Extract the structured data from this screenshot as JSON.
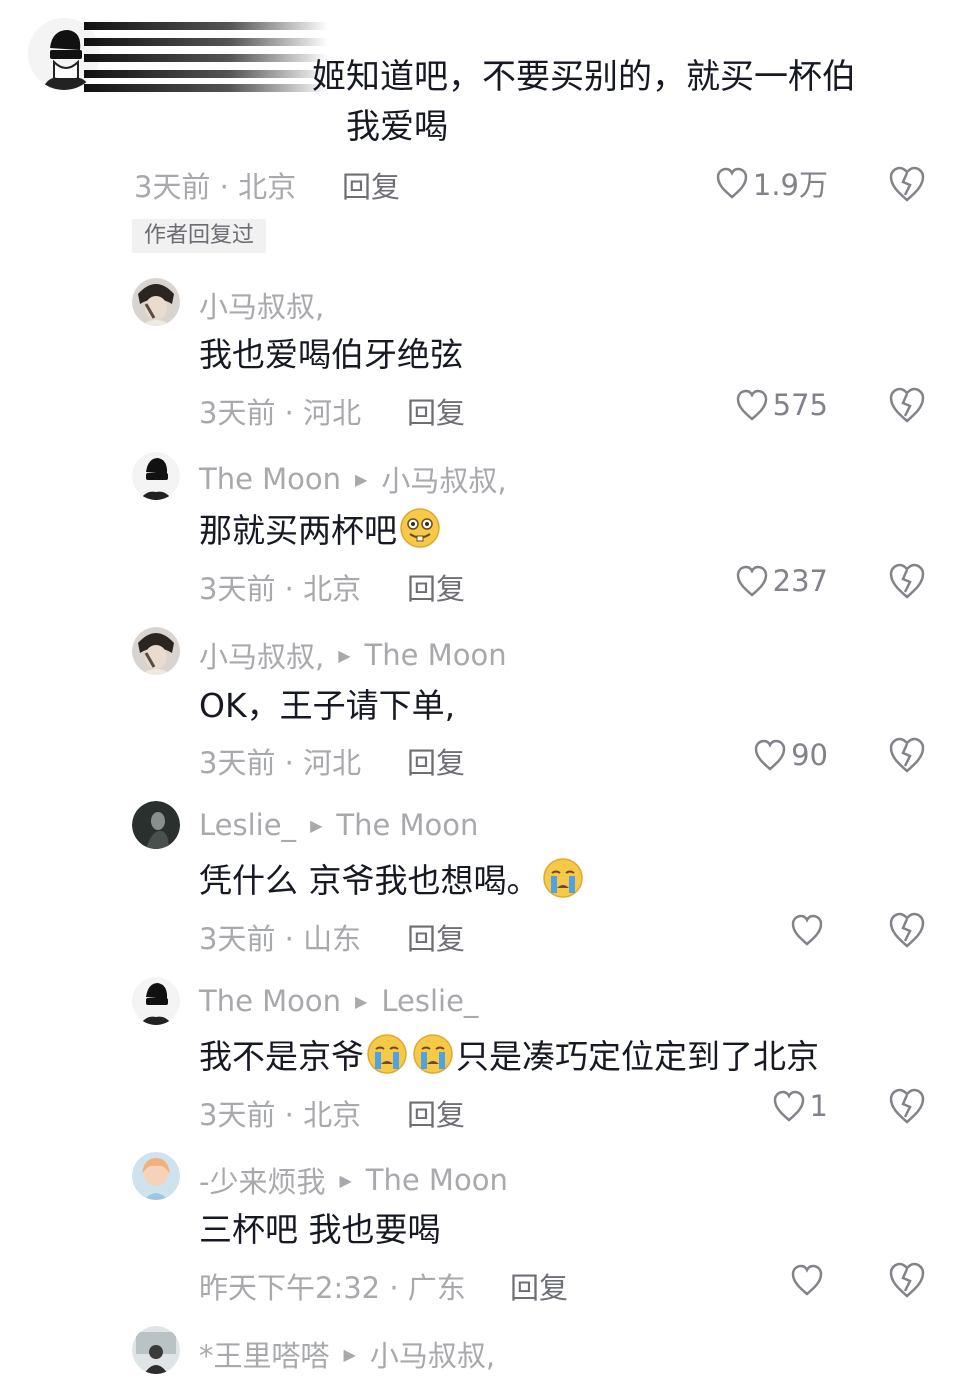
{
  "top_comment": {
    "line1": "姬知道吧，不要买别的，就买一杯伯",
    "line2": "我爱喝",
    "time_location": "3天前 · 北京",
    "reply_label": "回复",
    "likes": "1.9万",
    "author_replied_badge": "作者回复过"
  },
  "replies": [
    {
      "user": "小马叔叔,",
      "reply_to": "",
      "text": "我也爱喝伯牙绝弦",
      "time_location": "3天前 · 河北",
      "reply_label": "回复",
      "likes": "575"
    },
    {
      "user": "The Moon",
      "reply_to": "小马叔叔,",
      "text": "那就买两杯吧",
      "emoji": "silly-face-emoji",
      "time_location": "3天前 · 北京",
      "reply_label": "回复",
      "likes": "237"
    },
    {
      "user": "小马叔叔,",
      "reply_to": "The Moon",
      "text": "OK，王子请下单,",
      "time_location": "3天前 · 河北",
      "reply_label": "回复",
      "likes": "90"
    },
    {
      "user": "Leslie_",
      "reply_to": "The Moon",
      "text": "凭什么 京爷我也想喝。",
      "emoji": "crying-face-emoji",
      "time_location": "3天前 · 山东",
      "reply_label": "回复",
      "likes": ""
    },
    {
      "user": "The Moon",
      "reply_to": "Leslie_",
      "text_before": "我不是京爷",
      "text_after": "只是凑巧定位定到了北京",
      "emoji": "crying-face-emoji",
      "time_location": "3天前 · 北京",
      "reply_label": "回复",
      "likes": "1"
    },
    {
      "user": "-少来烦我",
      "reply_to": "The Moon",
      "text": "三杯吧 我也要喝",
      "time_location": "昨天下午2:32 · 广东",
      "reply_label": "回复",
      "likes": ""
    },
    {
      "user": "*王里嗒嗒",
      "reply_to": "小马叔叔,",
      "text": ""
    }
  ],
  "colors": {
    "text_primary": "#161823",
    "text_meta": "#a8a9ad",
    "reply_button": "#6e6f76",
    "icon": "#82838a",
    "emoji_yellow": "#f7c948",
    "tear_blue": "#4fa3e3"
  }
}
